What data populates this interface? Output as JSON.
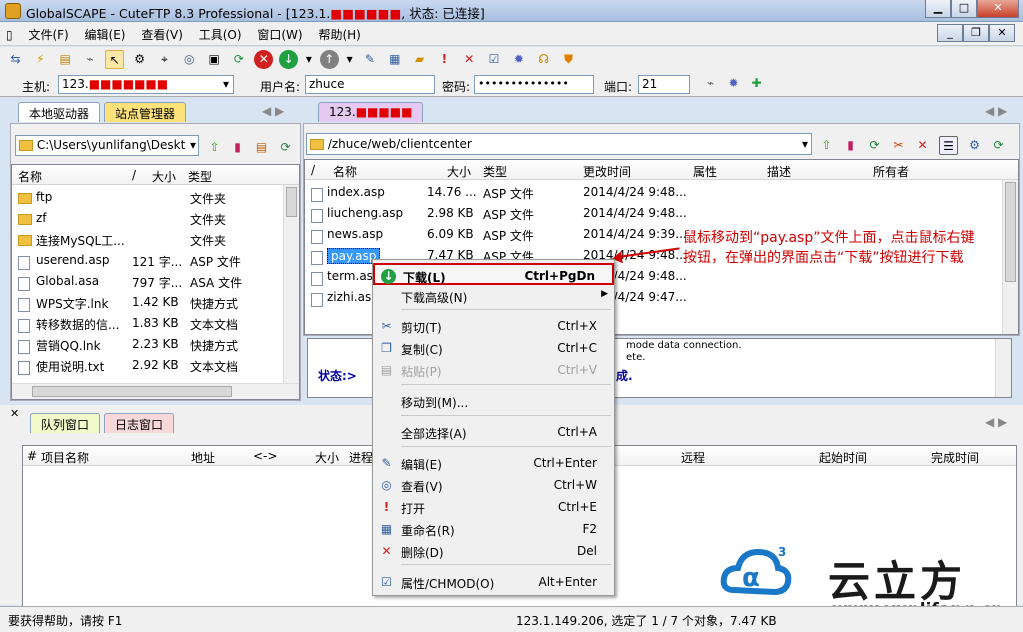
{
  "window": {
    "title_prefix": "GlobalSCAPE - CuteFTP 8.3 Professional - [123.1.",
    "title_suffix": ", 状态: 已连接]"
  },
  "menu": [
    "文件(F)",
    "编辑(E)",
    "查看(V)",
    "工具(O)",
    "窗口(W)",
    "帮助(H)"
  ],
  "connect": {
    "host_label": "主机:",
    "host_value": "123.",
    "user_label": "用户名:",
    "user_value": "zhuce",
    "pass_label": "密码:",
    "pass_value": "••••••••••••••",
    "port_label": "端口:",
    "port_value": "21"
  },
  "left": {
    "tabs": [
      "本地驱动器",
      "站点管理器"
    ],
    "path": "C:\\Users\\yunlifang\\Deskt",
    "headers": {
      "name": "名称",
      "slash": "/",
      "size": "大小",
      "type": "类型"
    },
    "rows": [
      {
        "name": "ftp",
        "size": "",
        "type": "文件夹",
        "icon": "folder"
      },
      {
        "name": "zf",
        "size": "",
        "type": "文件夹",
        "icon": "folder"
      },
      {
        "name": "连接MySQL工...",
        "size": "",
        "type": "文件夹",
        "icon": "folder"
      },
      {
        "name": "userend.asp",
        "size": "121 字...",
        "type": "ASP 文件",
        "icon": "file"
      },
      {
        "name": "Global.asa",
        "size": "797 字...",
        "type": "ASA 文件",
        "icon": "file"
      },
      {
        "name": "WPS文字.lnk",
        "size": "1.42 KB",
        "type": "快捷方式",
        "icon": "file"
      },
      {
        "name": "转移数据的信...",
        "size": "1.83 KB",
        "type": "文本文档",
        "icon": "file"
      },
      {
        "name": "营销QQ.lnk",
        "size": "2.23 KB",
        "type": "快捷方式",
        "icon": "file"
      },
      {
        "name": "使用说明.txt",
        "size": "2.92 KB",
        "type": "文本文档",
        "icon": "file"
      }
    ]
  },
  "right": {
    "tab": "123.",
    "path": "/zhuce/web/clientcenter",
    "headers": {
      "slash": "/",
      "name": "名称",
      "size": "大小",
      "type": "类型",
      "modified": "更改时间",
      "attr": "属性",
      "desc": "描述",
      "owner": "所有者"
    },
    "rows": [
      {
        "name": "index.asp",
        "size": "14.76 ...",
        "type": "ASP 文件",
        "modified": "2014/4/24 9:48..."
      },
      {
        "name": "liucheng.asp",
        "size": "2.98 KB",
        "type": "ASP 文件",
        "modified": "2014/4/24 9:48..."
      },
      {
        "name": "news.asp",
        "size": "6.09 KB",
        "type": "ASP 文件",
        "modified": "2014/4/24 9:39..."
      },
      {
        "name": "pay.asp",
        "size": "7.47 KB",
        "type": "ASP 文件",
        "modified": "2014/4/24 9:48..."
      },
      {
        "name": "term.asp",
        "size": "",
        "type": "",
        "modified": "2014/4/24 9:48..."
      },
      {
        "name": "zizhi.asp",
        "size": "",
        "type": "",
        "modified": "2014/4/24 9:47..."
      }
    ]
  },
  "log": {
    "line1": "mode data connection.",
    "line2": "ete.",
    "status_label": "状态:>",
    "status_tail": "成."
  },
  "annotation": {
    "line1": "鼠标移动到“pay.asp”文件上面，点击鼠标右键",
    "line2": "按钮，在弹出的界面点击“下载”按钮进行下载"
  },
  "queue": {
    "tabs": [
      "队列窗口",
      "日志窗口"
    ],
    "headers": {
      "hash": "#",
      "item": "项目名称",
      "addr": "地址",
      "dir": "<->",
      "size": "大小",
      "progress": "进程",
      "remote": "远程",
      "start": "起始时间",
      "end": "完成时间"
    }
  },
  "context_menu": [
    {
      "label": "下载(L)",
      "shortcut": "Ctrl+PgDn",
      "icon": "download-icon",
      "bold": true
    },
    {
      "label": "下载高级(N)",
      "shortcut": "",
      "icon": "",
      "submenu": true
    },
    {
      "label": "剪切(T)",
      "shortcut": "Ctrl+X",
      "icon": "cut-icon"
    },
    {
      "label": "复制(C)",
      "shortcut": "Ctrl+C",
      "icon": "copy-icon"
    },
    {
      "label": "粘贴(P)",
      "shortcut": "Ctrl+V",
      "icon": "paste-icon",
      "disabled": true
    },
    {
      "label": "移动到(M)...",
      "shortcut": "",
      "icon": ""
    },
    {
      "label": "全部选择(A)",
      "shortcut": "Ctrl+A",
      "icon": ""
    },
    {
      "label": "编辑(E)",
      "shortcut": "Ctrl+Enter",
      "icon": "edit-icon"
    },
    {
      "label": "查看(V)",
      "shortcut": "Ctrl+W",
      "icon": "view-icon"
    },
    {
      "label": "打开",
      "shortcut": "Ctrl+E",
      "icon": "open-icon"
    },
    {
      "label": "重命名(R)",
      "shortcut": "F2",
      "icon": "rename-icon"
    },
    {
      "label": "删除(D)",
      "shortcut": "Del",
      "icon": "delete-icon"
    },
    {
      "label": "属性/CHMOD(O)",
      "shortcut": "Alt+Enter",
      "icon": "properties-icon"
    }
  ],
  "watermark": {
    "brand": "云立方",
    "url": "www.yunlifang.cn"
  },
  "status": {
    "help": "要获得帮助，请按 F1",
    "selection": "123.1.149.206, 选定了 1 / 7 个对象，7.47 KB"
  },
  "colors": {
    "accent": "#d00000",
    "selection": "#3399ff",
    "link": "#0000cc"
  }
}
